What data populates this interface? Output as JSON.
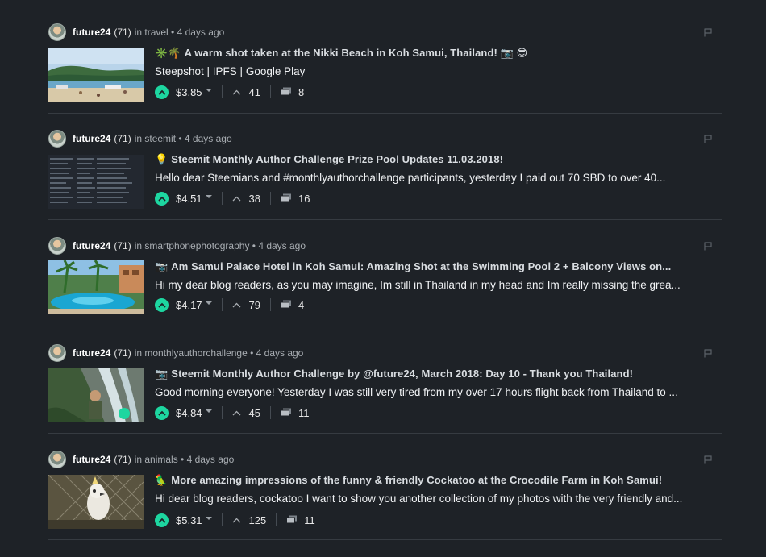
{
  "feed": {
    "posts": [
      {
        "author": "future24",
        "reputation": "(71)",
        "meta": "in travel • 4 days ago",
        "title_emoji": "✳️🌴",
        "title": "A warm shot taken at the Nikki Beach in Koh Samui, Thailand! 📷 😎",
        "excerpt": "Steepshot | IPFS | Google Play",
        "payout": "$3.85",
        "votes": "41",
        "comments": "8",
        "thumb": "beach"
      },
      {
        "author": "future24",
        "reputation": "(71)",
        "meta": "in steemit • 4 days ago",
        "title_emoji": "💡",
        "title": "Steemit Monthly Author Challenge Prize Pool Updates 11.03.2018!",
        "excerpt": "Hello dear Steemians and #monthlyauthorchallenge participants, yesterday I paid out 70 SBD to over 40...",
        "payout": "$4.51",
        "votes": "38",
        "comments": "16",
        "thumb": "table"
      },
      {
        "author": "future24",
        "reputation": "(71)",
        "meta": "in smartphonephotography • 4 days ago",
        "title_emoji": "📷",
        "title": "Am Samui Palace Hotel in Koh Samui: Amazing Shot at the Swimming Pool 2 + Balcony Views on...",
        "excerpt": "Hi my dear blog readers, as you may imagine, Im still in Thailand in my head and Im really missing the grea...",
        "payout": "$4.17",
        "votes": "79",
        "comments": "4",
        "thumb": "pool"
      },
      {
        "author": "future24",
        "reputation": "(71)",
        "meta": "in monthlyauthorchallenge • 4 days ago",
        "title_emoji": "📷",
        "title": "Steemit Monthly Author Challenge by @future24, March 2018: Day 10 - Thank you Thailand!",
        "excerpt": "Good morning everyone! Yesterday I was still very tired from my over 17 hours flight back from Thailand to ...",
        "payout": "$4.84",
        "votes": "45",
        "comments": "11",
        "thumb": "waterfall"
      },
      {
        "author": "future24",
        "reputation": "(71)",
        "meta": "in animals • 4 days ago",
        "title_emoji": "🦜",
        "title": "More amazing impressions of the funny & friendly Cockatoo at the Crocodile Farm in Koh Samui!",
        "excerpt": "Hi dear blog readers, cockatoo I want to show you another collection of my photos with the very friendly and...",
        "payout": "$5.31",
        "votes": "125",
        "comments": "11",
        "thumb": "cockatoo"
      }
    ]
  },
  "colors": {
    "background": "#1e2227",
    "upvote": "#1dd6a0",
    "divider": "#363b41"
  },
  "icons": [
    "flag-icon",
    "upvote-icon",
    "votes-chevron-icon",
    "comments-icon",
    "payout-caret-icon"
  ]
}
